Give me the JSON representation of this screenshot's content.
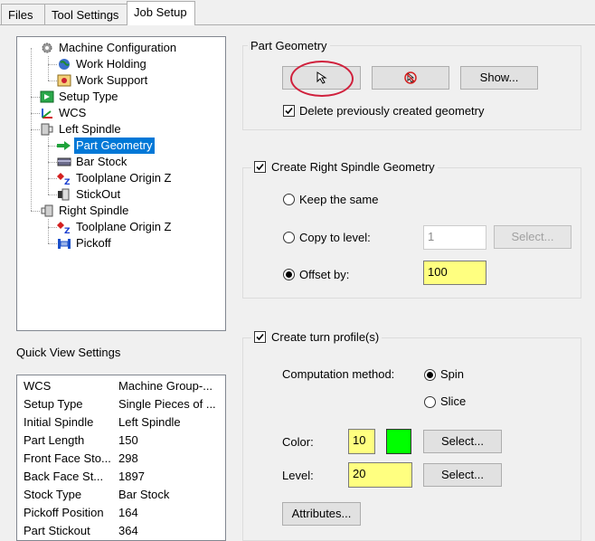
{
  "tabs": [
    {
      "label": "Files"
    },
    {
      "label": "Tool Settings"
    },
    {
      "label": "Job Setup",
      "active": true
    }
  ],
  "tree": {
    "items": [
      {
        "label": "Machine Configuration",
        "icon": "gear-icon"
      },
      {
        "label": "Work Holding",
        "icon": "globe-icon"
      },
      {
        "label": "Work Support",
        "icon": "work-support-icon"
      },
      {
        "label": "Setup Type",
        "icon": "setup-type-icon"
      },
      {
        "label": "WCS",
        "icon": "axes-icon"
      },
      {
        "label": "Left Spindle",
        "icon": "spindle-icon"
      },
      {
        "label": "Part Geometry",
        "icon": "part-arrow-icon",
        "selected": true
      },
      {
        "label": "Bar Stock",
        "icon": "bar-stock-icon"
      },
      {
        "label": "Toolplane Origin Z",
        "icon": "toolplane-z-icon"
      },
      {
        "label": "StickOut",
        "icon": "stickout-icon"
      },
      {
        "label": "Right Spindle",
        "icon": "spindle-icon"
      },
      {
        "label": "Toolplane Origin Z",
        "icon": "toolplane-z-icon"
      },
      {
        "label": "Pickoff",
        "icon": "pickoff-icon"
      }
    ]
  },
  "quick_view": {
    "title": "Quick View Settings",
    "rows": [
      {
        "key": "WCS",
        "value": "Machine Group-..."
      },
      {
        "key": "Setup Type",
        "value": "Single Pieces of ..."
      },
      {
        "key": "Initial Spindle",
        "value": "Left Spindle"
      },
      {
        "key": "Part Length",
        "value": "150"
      },
      {
        "key": "Front Face Sto...",
        "value": "298"
      },
      {
        "key": "Back Face St...",
        "value": "1897"
      },
      {
        "key": "Stock Type",
        "value": "Bar Stock"
      },
      {
        "key": "Pickoff Position",
        "value": "164"
      },
      {
        "key": "Part Stickout",
        "value": "364"
      }
    ]
  },
  "part_geometry": {
    "title": "Part Geometry",
    "show_label": "Show...",
    "delete_label": "Delete previously created geometry",
    "delete_checked": true
  },
  "right_spindle": {
    "title": "Create Right Spindle Geometry",
    "checked": true,
    "keep_label": "Keep the same",
    "copy_label": "Copy to level:",
    "copy_value": "1",
    "select_label": "Select...",
    "offset_label": "Offset by:",
    "offset_value": "100",
    "selected_option": "offset"
  },
  "turn_profile": {
    "title": "Create turn profile(s)",
    "checked": true,
    "method_label": "Computation method:",
    "spin_label": "Spin",
    "slice_label": "Slice",
    "selected_method": "spin",
    "color_label": "Color:",
    "color_value": "10",
    "swatch_color": "#00ff00",
    "color_select_label": "Select...",
    "level_label": "Level:",
    "level_value": "20",
    "level_select_label": "Select...",
    "attributes_label": "Attributes..."
  },
  "colors": {
    "selection": "#0078d7",
    "highlight_field": "#ffff80",
    "annotation_circle": "#d0203c"
  }
}
